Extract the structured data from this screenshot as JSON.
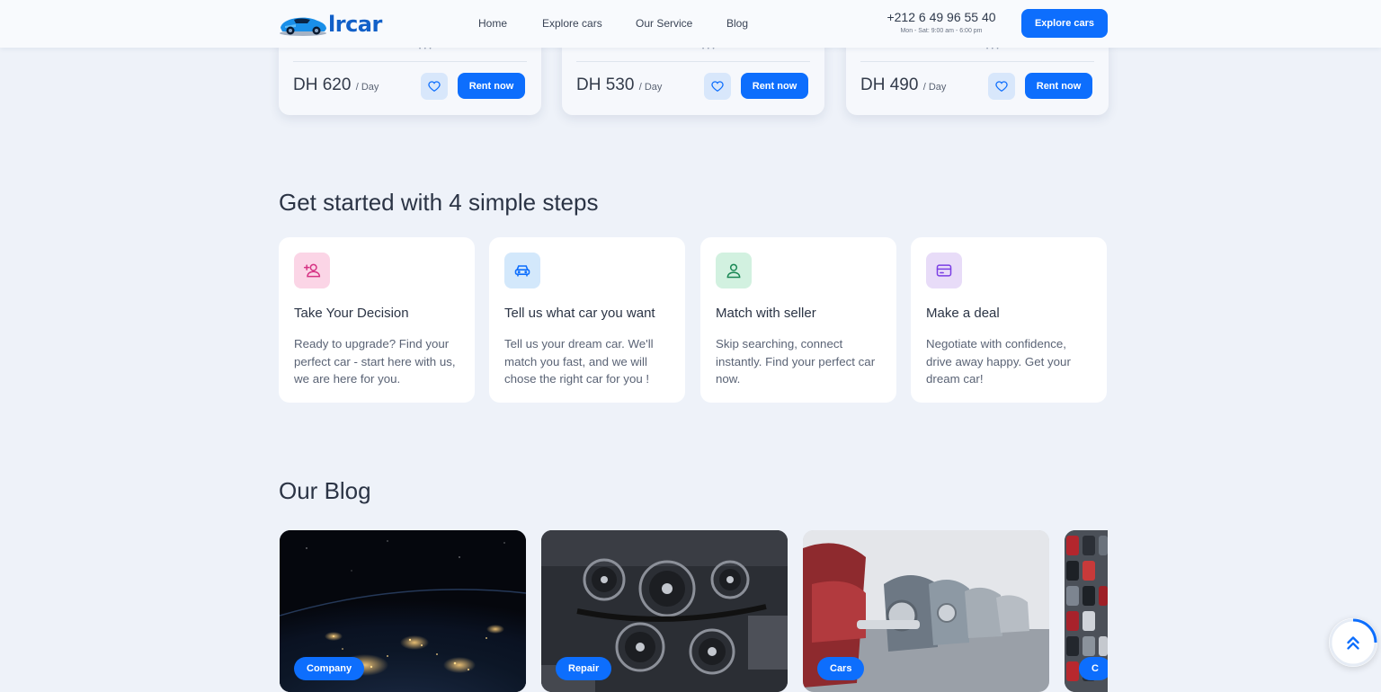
{
  "brand": {
    "name": "lrcar"
  },
  "nav": {
    "items": [
      "Home",
      "Explore cars",
      "Our Service",
      "Blog"
    ]
  },
  "contact": {
    "phone": "+212 6 49 96 55 40",
    "hours": "Mon - Sat: 9:00 am - 6:00 pm"
  },
  "header": {
    "cta_label": "Explore cars"
  },
  "cars": [
    {
      "price": "DH 620",
      "unit": "/ Day",
      "rent_label": "Rent now"
    },
    {
      "price": "DH 530",
      "unit": "/ Day",
      "rent_label": "Rent now"
    },
    {
      "price": "DH 490",
      "unit": "/ Day",
      "rent_label": "Rent now"
    }
  ],
  "steps": {
    "title": "Get started with 4 simple steps",
    "items": [
      {
        "icon": "user-add-icon",
        "title": "Take Your Decision",
        "desc": "Ready to upgrade? Find your perfect car - start here with us, we are here for you."
      },
      {
        "icon": "car-icon",
        "title": "Tell us what car you want",
        "desc": "Tell us your dream car. We'll match you fast, and we will chose the right car for you !"
      },
      {
        "icon": "user-icon",
        "title": "Match with seller",
        "desc": "Skip searching, connect instantly. Find your perfect car now."
      },
      {
        "icon": "credit-card-icon",
        "title": "Make a deal",
        "desc": "Negotiate with confidence, drive away happy. Get your dream car!"
      }
    ]
  },
  "blog": {
    "title": "Our Blog",
    "posts": [
      {
        "tag": "Company"
      },
      {
        "tag": "Repair"
      },
      {
        "tag": "Cars"
      },
      {
        "tag": "C"
      }
    ]
  },
  "colors": {
    "primary": "#0d6efd",
    "background": "#eef2f9",
    "step_pink": "#fbd5e6",
    "step_blue": "#d3e8fb",
    "step_green": "#d2f1e0",
    "step_purple": "#e8dcf8"
  }
}
